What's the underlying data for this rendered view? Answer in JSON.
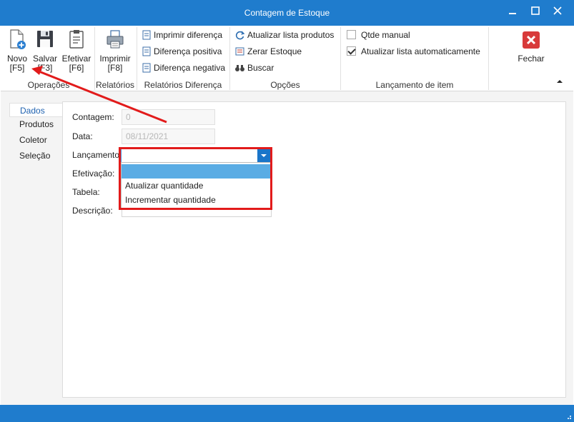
{
  "window": {
    "title": "Contagem de Estoque",
    "minimize_icon": "minimize-icon",
    "maximize_icon": "maximize-icon",
    "close_icon": "close-icon"
  },
  "ribbon": {
    "groups": {
      "operacoes": "Operações",
      "relatorios": "Relatórios",
      "relatorios_diferenca": "Relatórios Diferença",
      "opcoes": "Opções",
      "lancamento_item": "Lançamento de item"
    },
    "novo": {
      "label": "Novo",
      "key": "[F5]",
      "icon": "new-document-icon"
    },
    "salvar": {
      "label": "Salvar",
      "key": "[F3]",
      "icon": "floppy-disk-icon"
    },
    "efetivar": {
      "label": "Efetivar",
      "key": "[F6]",
      "icon": "clipboard-icon"
    },
    "imprimir": {
      "label": "Imprimir",
      "key": "[F8]",
      "icon": "printer-icon"
    },
    "imprimir_diferenca": "Imprimir diferença",
    "diferenca_positiva": "Diferença positiva",
    "diferenca_negativa": "Diferença negativa",
    "atualizar_lista": "Atualizar lista produtos",
    "zerar_estoque": "Zerar Estoque",
    "buscar": "Buscar",
    "qtde_manual": {
      "label": "Qtde manual",
      "checked": false
    },
    "atualizar_auto": {
      "label": "Atualizar lista automaticamente",
      "checked": true
    },
    "fechar": {
      "label": "Fechar",
      "icon": "close-red-icon"
    }
  },
  "tabs": [
    "Dados",
    "Produtos",
    "Coletor",
    "Seleção"
  ],
  "form": {
    "contagem": {
      "label": "Contagem:",
      "value": "0"
    },
    "data": {
      "label": "Data:",
      "value": "08/11/2021"
    },
    "lancamento": {
      "label": "Lançamento:",
      "value": ""
    },
    "efetivacao": {
      "label": "Efetivação:"
    },
    "tabela": {
      "label": "Tabela:"
    },
    "descricao": {
      "label": "Descrição:"
    }
  },
  "dropdown": {
    "options": [
      "",
      "Atualizar quantidade",
      "Incrementar quantidade"
    ],
    "selected_index": 0
  },
  "colors": {
    "titlebar": "#1f7ccd",
    "highlight": "#e21b1b",
    "selection": "#5aace4"
  }
}
